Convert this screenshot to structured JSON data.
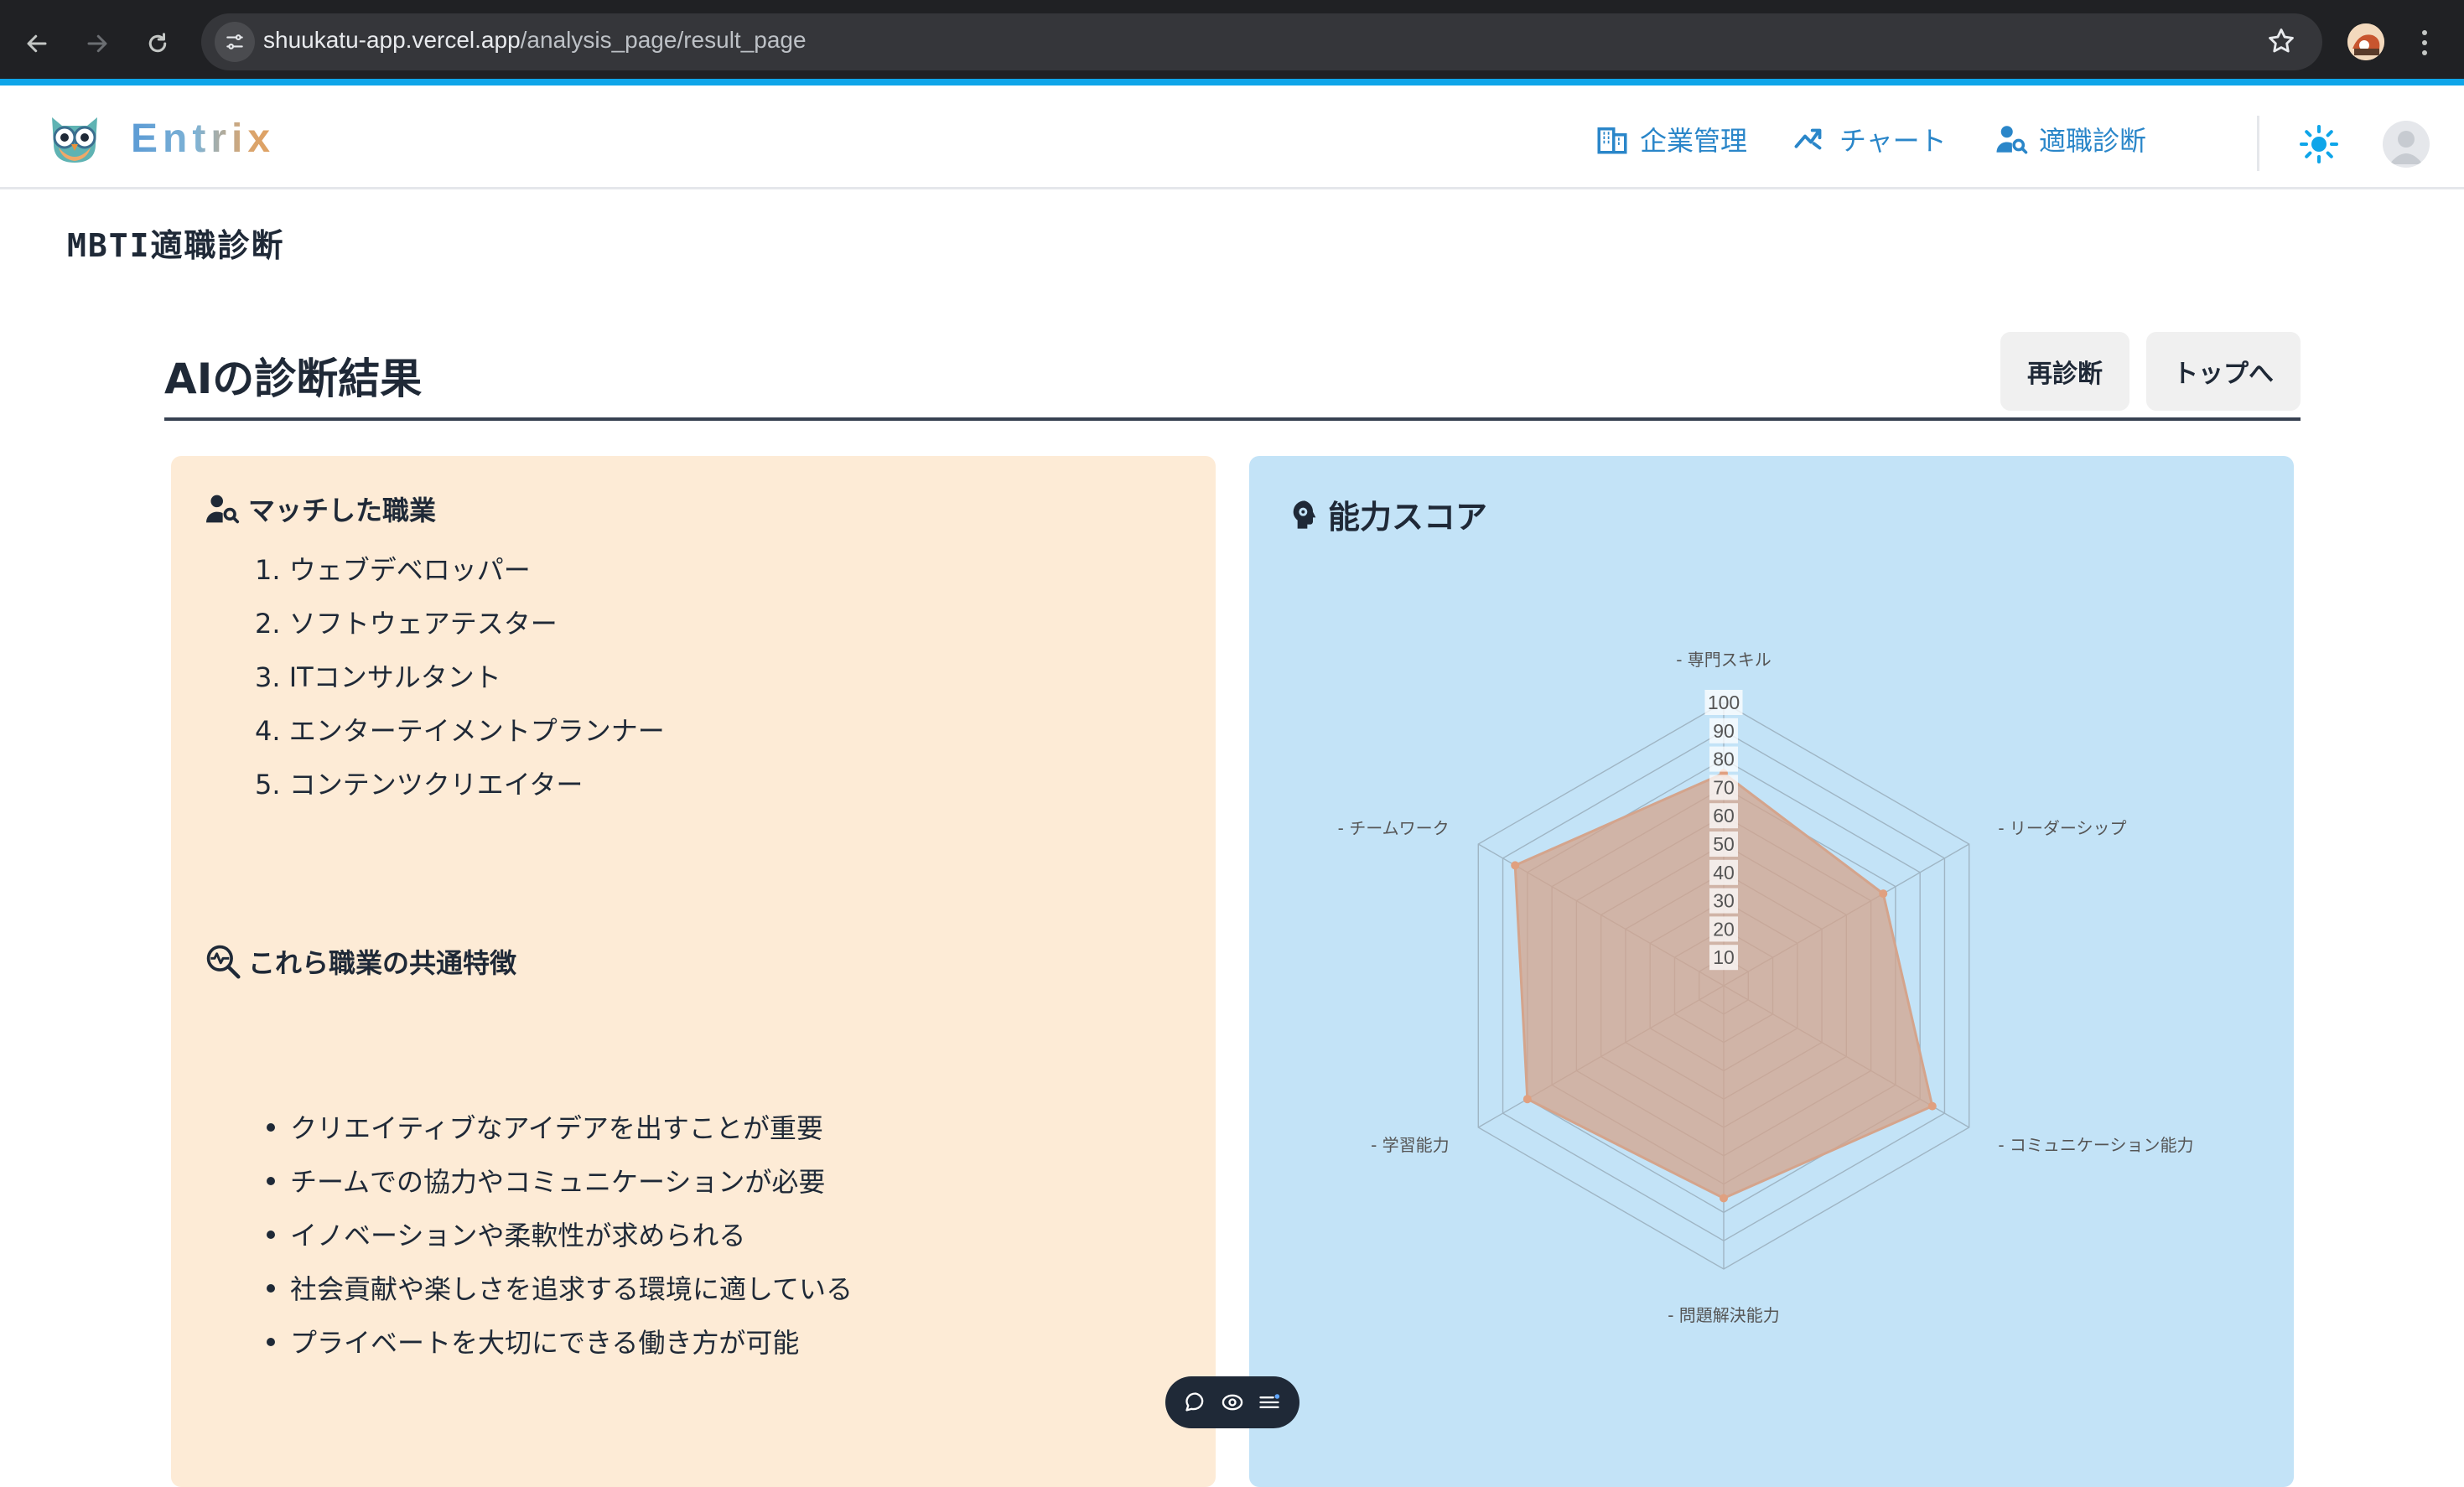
{
  "browser": {
    "url_host": "shuukatu-app.vercel.app",
    "url_path": "/analysis_page/result_page"
  },
  "header": {
    "brand": "Entrix",
    "nav": [
      {
        "label": "企業管理",
        "icon": "building-icon"
      },
      {
        "label": "チャート",
        "icon": "trend-icon"
      },
      {
        "label": "適職診断",
        "icon": "user-search-icon"
      }
    ]
  },
  "page": {
    "title": "MBTI適職診断",
    "section_title": "AIの診断結果",
    "buttons": {
      "retry": "再診断",
      "top": "トップへ"
    }
  },
  "matched": {
    "heading": "マッチした職業",
    "jobs": [
      "1. ウェブデベロッパー",
      "2. ソフトウェアテスター",
      "3. ITコンサルタント",
      "4. エンターテイメントプランナー",
      "5. コンテンツクリエイター"
    ]
  },
  "traits": {
    "heading": "これら職業の共通特徴",
    "items": [
      "クリエイティブなアイデアを出すことが重要",
      "チームでの協力やコミュニケーションが必要",
      "イノベーションや柔軟性が求められる",
      "社会貢献や楽しさを追求する環境に適している",
      "プライベートを大切にできる働き方が可能"
    ]
  },
  "ability": {
    "heading": "能力スコア"
  },
  "chart_data": {
    "type": "radar",
    "axes": [
      "- 専門スキル",
      "- リーダーシップ",
      "- コミュニケーション能力",
      "- 問題解決能力",
      "- 学習能力",
      "- チームワーク"
    ],
    "ticks": [
      "10",
      "20",
      "30",
      "40",
      "50",
      "60",
      "70",
      "80",
      "90",
      "100"
    ],
    "rmax": 100,
    "series": [
      {
        "values": [
          75,
          65,
          85,
          75,
          80,
          85
        ],
        "color": "#d4a48c"
      }
    ],
    "grid": true
  }
}
